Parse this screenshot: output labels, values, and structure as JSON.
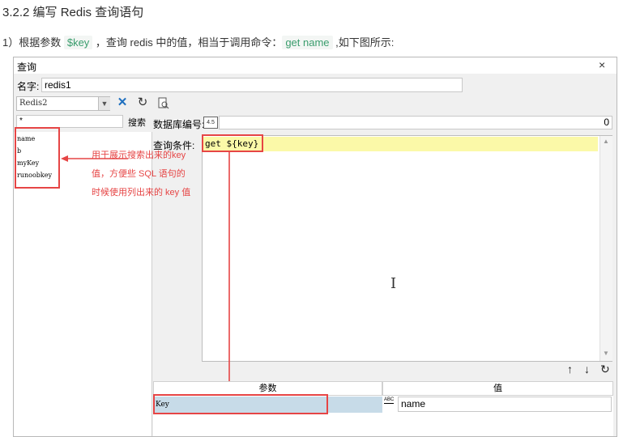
{
  "heading": "3.2.2 编写 Redis 查询语句",
  "paragraph": {
    "prefix": "1）根据参数 ",
    "param": "$key",
    "middle": " ，查询 redis 中的值，相当于调用命令：",
    "command": "get name",
    "suffix": " ,如下图所示:"
  },
  "dialog": {
    "title": "查询",
    "close_glyph": "×",
    "name_label": "名字:",
    "name_value": "redis1",
    "connection_value": "Redis2",
    "search_input_value": "*",
    "search_button": "搜索",
    "db_label": "数据库编号:",
    "db_badge": "4.5",
    "db_value": "0",
    "keys": [
      "name",
      "b",
      "myKey",
      "runoobkey"
    ],
    "annotation": [
      "用于展示搜索出来的key",
      "值，方便些 SQL 语句的",
      "时候使用列出来的 key 值"
    ],
    "query_label": "查询条件:",
    "query_text": "get ${key}",
    "param_table": {
      "headers": [
        "参数",
        "值"
      ],
      "rows": [
        {
          "param": "Key",
          "type_badge": "ABC",
          "value": "name"
        }
      ]
    }
  },
  "colors": {
    "annotation_red": "#e64545",
    "code_green": "#3a9d6d",
    "highlight_yellow": "#fbf9a8",
    "selected_row_blue": "#c7dbe8",
    "tool_blue": "#1e6fbf"
  },
  "icons": [
    "close-icon",
    "dropdown-arrow-icon",
    "tools-icon",
    "refresh-icon",
    "document-search-icon",
    "text-cursor-icon",
    "arrow-up-icon",
    "arrow-down-icon",
    "reload-icon",
    "text-type-icon"
  ]
}
